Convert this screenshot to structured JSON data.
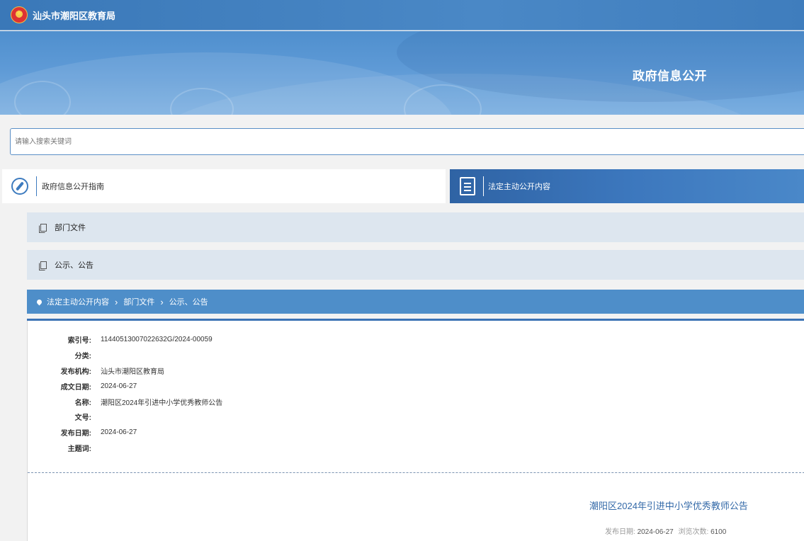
{
  "header": {
    "site_name": "汕头市潮阳区教育局",
    "banner_title": "政府信息公开"
  },
  "search": {
    "placeholder": "请输入搜索关键词"
  },
  "tabs": [
    {
      "label": "政府信息公开指南",
      "icon": "compass-icon"
    },
    {
      "label": "法定主动公开内容",
      "icon": "document-icon"
    }
  ],
  "categories": [
    {
      "label": "部门文件",
      "icon": "copy-icon"
    },
    {
      "label": "公示、公告",
      "icon": "copy-icon"
    }
  ],
  "breadcrumb": [
    "法定主动公开内容",
    "部门文件",
    "公示、公告"
  ],
  "meta": [
    {
      "key": "索引号:",
      "value": "11440513007022632G/2024-00059"
    },
    {
      "key": "分类:",
      "value": ""
    },
    {
      "key": "发布机构:",
      "value": "汕头市潮阳区教育局"
    },
    {
      "key": "成文日期:",
      "value": "2024-06-27"
    },
    {
      "key": "名称:",
      "value": "潮阳区2024年引进中小学优秀教师公告"
    },
    {
      "key": "文号:",
      "value": ""
    },
    {
      "key": "发布日期:",
      "value": "2024-06-27"
    },
    {
      "key": "主题词:",
      "value": ""
    }
  ],
  "document": {
    "title": "潮阳区2024年引进中小学优秀教师公告",
    "publish_label": "发布日期:",
    "publish_date": "2024-06-27",
    "views_label": "浏览次数:",
    "views": "6100"
  },
  "colors": {
    "brand_blue": "#4e8ec9",
    "tab_active": "#3c77bd",
    "category_bg": "#dde6ef"
  }
}
